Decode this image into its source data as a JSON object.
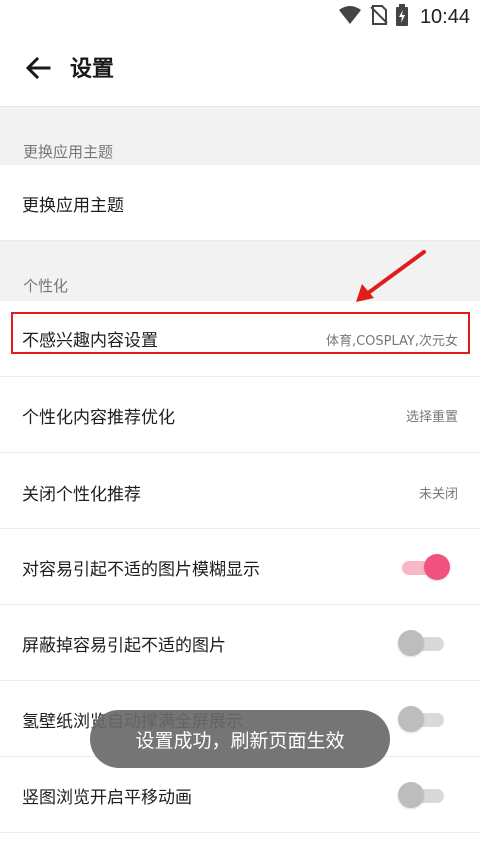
{
  "status_bar": {
    "time": "10:44",
    "icons": [
      "wifi-icon",
      "no-sim-icon",
      "battery-charging-icon"
    ]
  },
  "app_bar": {
    "back_icon": "arrow-left-icon",
    "title": "设置"
  },
  "sections": [
    {
      "header": "更换应用主题",
      "rows": [
        {
          "label": "更换应用主题"
        }
      ]
    },
    {
      "header": "个性化",
      "rows": [
        {
          "label": "不感兴趣内容设置",
          "value": "体育,COSPLAY,次元女"
        },
        {
          "label": "个性化内容推荐优化",
          "value": "选择重置"
        },
        {
          "label": "关闭个性化推荐",
          "value": "未关闭"
        },
        {
          "label": "对容易引起不适的图片模糊显示",
          "toggle": true
        },
        {
          "label": "屏蔽掉容易引起不适的图片",
          "toggle": false
        },
        {
          "label": "氢壁纸浏览自动撑满全屏展示",
          "toggle": false
        },
        {
          "label": "竖图浏览开启平移动画",
          "toggle": false
        }
      ]
    }
  ],
  "toast": "设置成功，刷新页面生效",
  "colors": {
    "accent": "#f0527d",
    "highlight": "#e21b1b",
    "section_bg": "#f2f2f2"
  }
}
